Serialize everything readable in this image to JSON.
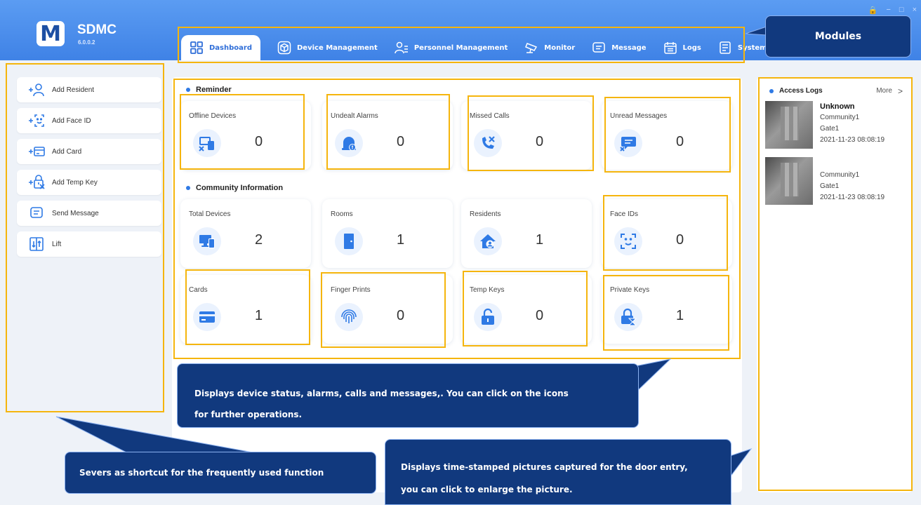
{
  "app": {
    "name": "SDMC",
    "version": "6.0.0.2",
    "logo_letter": "M"
  },
  "window_controls": [
    "🔒",
    "−",
    "□",
    "×"
  ],
  "tabs": [
    {
      "label": "Dashboard",
      "icon": "dashboard-icon",
      "active": true
    },
    {
      "label": "Device Management",
      "icon": "cube-icon",
      "active": false
    },
    {
      "label": "Personnel Management",
      "icon": "person-list-icon",
      "active": false
    },
    {
      "label": "Monitor",
      "icon": "camera-icon",
      "active": false
    },
    {
      "label": "Message",
      "icon": "message-icon",
      "active": false
    },
    {
      "label": "Logs",
      "icon": "calendar-icon",
      "active": false
    },
    {
      "label": "System",
      "icon": "document-icon",
      "active": false
    }
  ],
  "sidebar": {
    "items": [
      {
        "label": "Add Resident",
        "icon": "add-person-icon"
      },
      {
        "label": "Add Face ID",
        "icon": "add-face-icon"
      },
      {
        "label": "Add Card",
        "icon": "add-card-icon"
      },
      {
        "label": "Add Temp Key",
        "icon": "add-temp-key-icon"
      },
      {
        "label": "Send Message",
        "icon": "message-icon"
      },
      {
        "label": "Lift",
        "icon": "lift-icon"
      }
    ]
  },
  "reminder": {
    "title": "Reminder",
    "cards": [
      {
        "label": "Offline Devices",
        "value": "0",
        "icon": "offline-device-icon"
      },
      {
        "label": "Undealt Alarms",
        "value": "0",
        "icon": "alarm-icon"
      },
      {
        "label": "Missed Calls",
        "value": "0",
        "icon": "missed-call-icon"
      },
      {
        "label": "Unread Messages",
        "value": "0",
        "icon": "unread-message-icon"
      }
    ]
  },
  "community": {
    "title": "Community Information",
    "cards": [
      {
        "label": "Total Devices",
        "value": "2",
        "icon": "devices-icon"
      },
      {
        "label": "Rooms",
        "value": "1",
        "icon": "door-icon"
      },
      {
        "label": "Residents",
        "value": "1",
        "icon": "resident-home-icon"
      },
      {
        "label": "Face IDs",
        "value": "0",
        "icon": "face-id-icon"
      },
      {
        "label": "Cards",
        "value": "1",
        "icon": "card-icon"
      },
      {
        "label": "Finger Prints",
        "value": "0",
        "icon": "fingerprint-icon"
      },
      {
        "label": "Temp Keys",
        "value": "0",
        "icon": "unlock-icon"
      },
      {
        "label": "Private Keys",
        "value": "1",
        "icon": "private-key-icon"
      }
    ]
  },
  "access_logs": {
    "title": "Access Logs",
    "more_label": "More",
    "more_chevron": ">",
    "entries": [
      {
        "name": "Unknown",
        "community": "Community1",
        "gate": "Gate1",
        "time": "2021-11-23 08:08:19"
      },
      {
        "name": "",
        "community": "Community1",
        "gate": "Gate1",
        "time": "2021-11-23 08:08:19"
      }
    ]
  },
  "annotations": {
    "modules": "Modules",
    "shortcut": "Severs as shortcut for the frequently used function",
    "dashboard_line1": "Displays device status, alarms, calls and messages,. You can click on the icons",
    "dashboard_line2": "for further operations.",
    "logs_line1": "Displays time-stamped pictures captured for the door entry,",
    "logs_line2": "you can click to enlarge the picture."
  },
  "colors": {
    "header": "#3f82e6",
    "accent": "#2f7ae5",
    "annotation_box": "#f5b50d",
    "callout": "#11397e"
  }
}
